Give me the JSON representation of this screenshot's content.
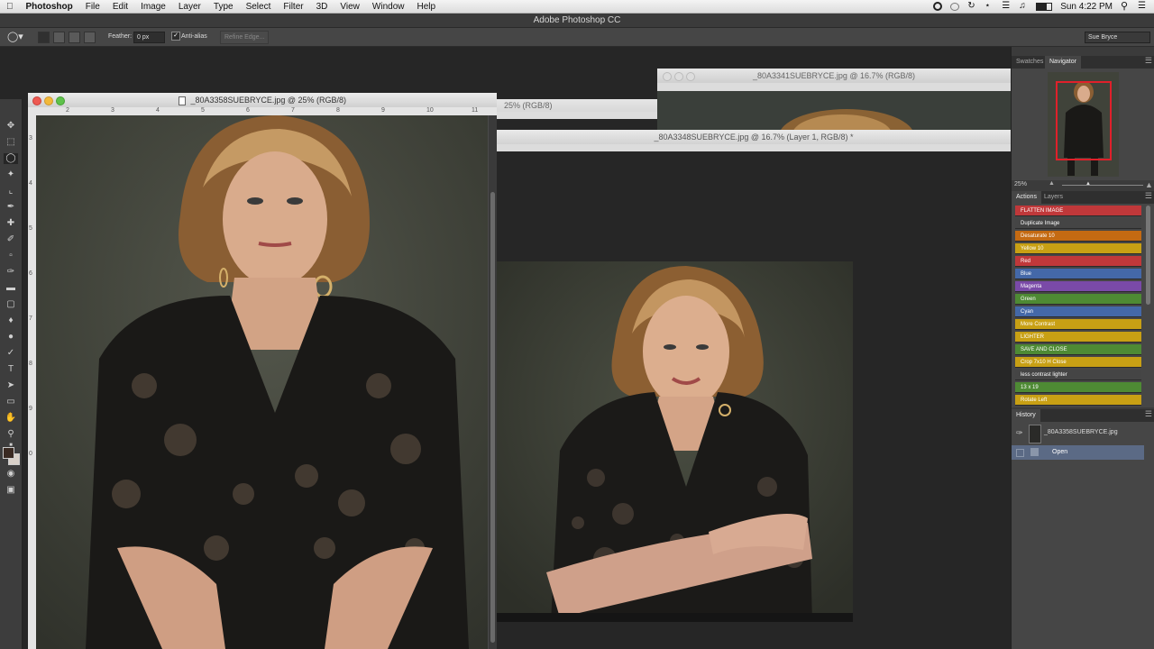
{
  "menubar": {
    "app": "Photoshop",
    "items": [
      "File",
      "Edit",
      "Image",
      "Layer",
      "Type",
      "Select",
      "Filter",
      "3D",
      "View",
      "Window",
      "Help"
    ],
    "clock": "Sun 4:22 PM"
  },
  "app_title": "Adobe Photoshop CC",
  "options": {
    "feather_label": "Feather:",
    "feather_value": "0 px",
    "anti_alias_label": "Anti-alias",
    "refine_edge_label": "Refine Edge...",
    "workspace": "Sue Bryce"
  },
  "documents": {
    "doc1_title": "_80A3358SUEBRYCE.jpg @ 25% (RGB/8)",
    "doc2_title": "_80A3341SUEBRYCE.jpg @ 16.7% (RGB/8)",
    "doc3_title": "_80A3348SUEBRYCE.jpg @ 16.7% (Layer 1, RGB/8) *",
    "doc_hidden_title": "25% (RGB/8)",
    "ruler_ticks": [
      "2",
      "3",
      "4",
      "5",
      "6",
      "7",
      "8",
      "9",
      "10",
      "11"
    ],
    "vruler_ticks": [
      "3",
      "4",
      "5",
      "6",
      "7",
      "8",
      "9",
      "0"
    ]
  },
  "navigator": {
    "tabs": [
      "Swatches",
      "Navigator"
    ],
    "zoom": "25%"
  },
  "actions": {
    "tabs": [
      "Actions",
      "Layers"
    ],
    "items": [
      {
        "label": "FLATTEN IMAGE",
        "color": "#c0383a"
      },
      {
        "label": "Duplicate Image",
        "color": "#454545"
      },
      {
        "label": "Desaturate 10",
        "color": "#c46a12"
      },
      {
        "label": "Yellow 10",
        "color": "#c8a014"
      },
      {
        "label": "Red",
        "color": "#c0383a"
      },
      {
        "label": "Blue",
        "color": "#4468a8"
      },
      {
        "label": "Magenta",
        "color": "#7a4aa8"
      },
      {
        "label": "Green",
        "color": "#4e8a34"
      },
      {
        "label": "Cyan",
        "color": "#4468a8"
      },
      {
        "label": "More Contrast",
        "color": "#c8a014"
      },
      {
        "label": "LIGHTER",
        "color": "#c8a014"
      },
      {
        "label": "SAVE AND CLOSE",
        "color": "#4e8a34"
      },
      {
        "label": "Crop 7x10 H Close",
        "color": "#c8a014"
      },
      {
        "label": "less contrast lighter",
        "color": "#454545"
      },
      {
        "label": "13 x 19",
        "color": "#4e8a34"
      },
      {
        "label": "Rotate Left",
        "color": "#c8a014"
      }
    ]
  },
  "history": {
    "tab": "History",
    "snapshot": "_80A3358SUEBRYCE.jpg",
    "state": "Open"
  }
}
